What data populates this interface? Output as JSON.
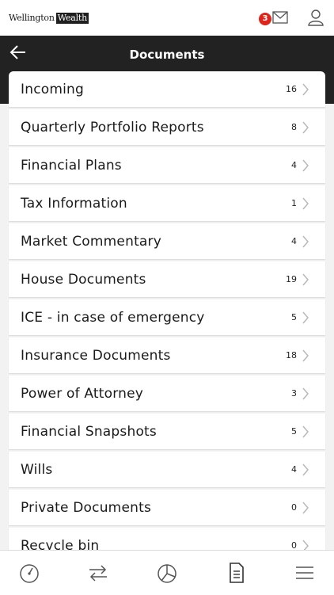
{
  "app": {
    "logo_word1": "Wellington",
    "logo_word2": "Wealth",
    "notification_count": "3"
  },
  "header": {
    "title": "Documents"
  },
  "folders": [
    {
      "label": "Incoming",
      "count": "16"
    },
    {
      "label": "Quarterly Portfolio Reports",
      "count": "8"
    },
    {
      "label": "Financial Plans",
      "count": "4"
    },
    {
      "label": "Tax Information",
      "count": "1"
    },
    {
      "label": "Market Commentary",
      "count": "4"
    },
    {
      "label": "House Documents",
      "count": "19"
    },
    {
      "label": "ICE - in case of emergency",
      "count": "5"
    },
    {
      "label": "Insurance Documents",
      "count": "18"
    },
    {
      "label": "Power of Attorney",
      "count": "3"
    },
    {
      "label": "Financial Snapshots",
      "count": "5"
    },
    {
      "label": "Wills",
      "count": "4"
    },
    {
      "label": "Private Documents",
      "count": "0"
    },
    {
      "label": "Recycle bin",
      "count": "0"
    }
  ],
  "tabs": [
    {
      "name": "dashboard",
      "icon": "gauge-icon"
    },
    {
      "name": "transfers",
      "icon": "transfer-arrows-icon"
    },
    {
      "name": "portfolio",
      "icon": "pie-chart-icon"
    },
    {
      "name": "documents",
      "icon": "document-icon"
    },
    {
      "name": "menu",
      "icon": "hamburger-menu-icon"
    }
  ],
  "colors": {
    "header_bg": "#222222",
    "badge": "#e0241b",
    "background": "#f2f2f2"
  }
}
